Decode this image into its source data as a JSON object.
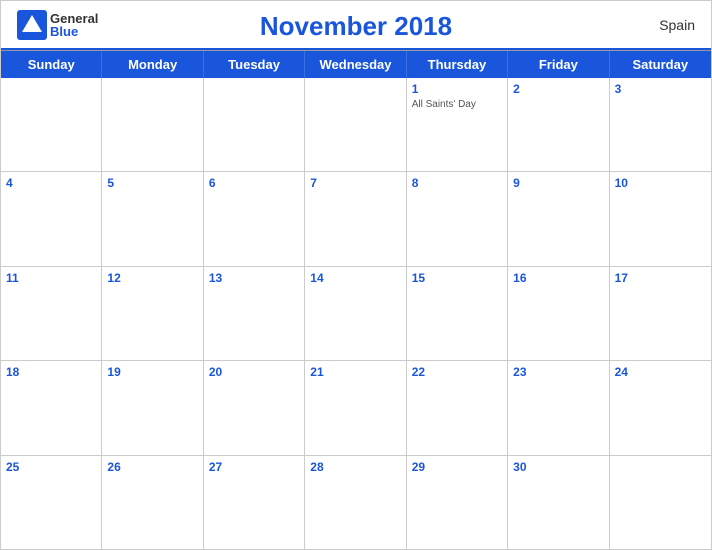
{
  "header": {
    "logo_general": "General",
    "logo_blue": "Blue",
    "title": "November 2018",
    "country": "Spain"
  },
  "day_headers": [
    "Sunday",
    "Monday",
    "Tuesday",
    "Wednesday",
    "Thursday",
    "Friday",
    "Saturday"
  ],
  "weeks": [
    [
      {
        "day": "",
        "event": ""
      },
      {
        "day": "",
        "event": ""
      },
      {
        "day": "",
        "event": ""
      },
      {
        "day": "",
        "event": ""
      },
      {
        "day": "1",
        "event": "All Saints' Day"
      },
      {
        "day": "2",
        "event": ""
      },
      {
        "day": "3",
        "event": ""
      }
    ],
    [
      {
        "day": "4",
        "event": ""
      },
      {
        "day": "5",
        "event": ""
      },
      {
        "day": "6",
        "event": ""
      },
      {
        "day": "7",
        "event": ""
      },
      {
        "day": "8",
        "event": ""
      },
      {
        "day": "9",
        "event": ""
      },
      {
        "day": "10",
        "event": ""
      }
    ],
    [
      {
        "day": "11",
        "event": ""
      },
      {
        "day": "12",
        "event": ""
      },
      {
        "day": "13",
        "event": ""
      },
      {
        "day": "14",
        "event": ""
      },
      {
        "day": "15",
        "event": ""
      },
      {
        "day": "16",
        "event": ""
      },
      {
        "day": "17",
        "event": ""
      }
    ],
    [
      {
        "day": "18",
        "event": ""
      },
      {
        "day": "19",
        "event": ""
      },
      {
        "day": "20",
        "event": ""
      },
      {
        "day": "21",
        "event": ""
      },
      {
        "day": "22",
        "event": ""
      },
      {
        "day": "23",
        "event": ""
      },
      {
        "day": "24",
        "event": ""
      }
    ],
    [
      {
        "day": "25",
        "event": ""
      },
      {
        "day": "26",
        "event": ""
      },
      {
        "day": "27",
        "event": ""
      },
      {
        "day": "28",
        "event": ""
      },
      {
        "day": "29",
        "event": ""
      },
      {
        "day": "30",
        "event": ""
      },
      {
        "day": "",
        "event": ""
      }
    ]
  ]
}
